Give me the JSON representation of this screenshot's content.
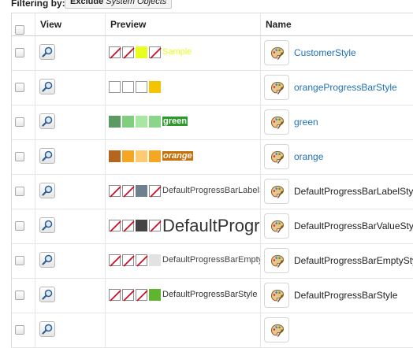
{
  "filter": {
    "label": "Filtering by:",
    "button_bold": "Exclude",
    "button_rest": "System Objects"
  },
  "columns": {
    "view": "View",
    "preview": "Preview",
    "name": "Name"
  },
  "rows": [
    {
      "name": "CustomerStyle",
      "name_is_link": true,
      "swatches": [
        {
          "color": null
        },
        {
          "color": null
        },
        {
          "color": "#e6ff1e"
        },
        {
          "color": null
        }
      ],
      "sample_text": "Sample",
      "sample_color": "#e6ff1e",
      "sample_bg": "transparent",
      "sample_style": "normal",
      "sample_weight": "normal",
      "sample_big": false
    },
    {
      "name": "orangeProgressBarStyle",
      "name_is_link": true,
      "swatches": [
        {
          "color": "#ffffff"
        },
        {
          "color": "#ffffff"
        },
        {
          "color": "#ffffff"
        },
        {
          "color": "#f5c400"
        }
      ],
      "sample_text": "",
      "sample_color": "#000000",
      "sample_bg": "transparent",
      "sample_style": "normal",
      "sample_weight": "normal",
      "sample_big": false
    },
    {
      "name": "green",
      "name_is_link": true,
      "swatches": [
        {
          "color": "#5b9a63"
        },
        {
          "color": "#7fcf7f"
        },
        {
          "color": "#a7e7a0"
        },
        {
          "color": "#8ad58a"
        }
      ],
      "sample_text": "green",
      "sample_color": "#ffffff",
      "sample_bg": "#2e9a2e",
      "sample_style": "normal",
      "sample_weight": "bold",
      "sample_big": false
    },
    {
      "name": "orange",
      "name_is_link": true,
      "swatches": [
        {
          "color": "#b5651d"
        },
        {
          "color": "#f5a623"
        },
        {
          "color": "#ffcb72"
        },
        {
          "color": "#f5a623"
        }
      ],
      "sample_text": "orange",
      "sample_color": "#ffffff",
      "sample_bg": "#c8710a",
      "sample_style": "italic",
      "sample_weight": "bold",
      "sample_big": false
    },
    {
      "name": "DefaultProgressBarLabelStyle",
      "name_is_link": false,
      "swatches": [
        {
          "color": null
        },
        {
          "color": null
        },
        {
          "color": "#6e7f8e"
        },
        {
          "color": null
        }
      ],
      "sample_text": "DefaultProgressBarLabelStyle",
      "sample_color": "#444444",
      "sample_bg": "transparent",
      "sample_style": "normal",
      "sample_weight": "normal",
      "sample_big": false
    },
    {
      "name": "DefaultProgressBarValueStyle",
      "name_is_link": false,
      "swatches": [
        {
          "color": null
        },
        {
          "color": null
        },
        {
          "color": "#444444"
        },
        {
          "color": null
        }
      ],
      "sample_text": "DefaultProgressBarValueStyle",
      "sample_color": "#333333",
      "sample_bg": "transparent",
      "sample_style": "normal",
      "sample_weight": "normal",
      "sample_big": true
    },
    {
      "name": "DefaultProgressBarEmptyStyle",
      "name_is_link": false,
      "swatches": [
        {
          "color": null
        },
        {
          "color": null
        },
        {
          "color": null
        },
        {
          "color": "#e2e2e2"
        }
      ],
      "sample_text": "DefaultProgressBarEmptyStyle",
      "sample_color": "#444444",
      "sample_bg": "transparent",
      "sample_style": "normal",
      "sample_weight": "normal",
      "sample_big": false
    },
    {
      "name": "DefaultProgressBarStyle",
      "name_is_link": false,
      "swatches": [
        {
          "color": null
        },
        {
          "color": null
        },
        {
          "color": null
        },
        {
          "color": "#5fb52f"
        }
      ],
      "sample_text": "DefaultProgressBarStyle",
      "sample_color": "#333333",
      "sample_bg": "transparent",
      "sample_style": "normal",
      "sample_weight": "normal",
      "sample_big": false
    },
    {
      "name": "",
      "name_is_link": false,
      "swatches": [],
      "sample_text": "",
      "sample_color": "#333333",
      "sample_bg": "transparent",
      "sample_style": "normal",
      "sample_weight": "normal",
      "sample_big": false
    }
  ],
  "icons": {
    "view": "magnifier-icon",
    "edit": "paint-palette-icon",
    "no_color": "no-color-slash-icon"
  },
  "colors": {
    "link": "#1f72b8",
    "no_color_slash": "#d0021b"
  }
}
